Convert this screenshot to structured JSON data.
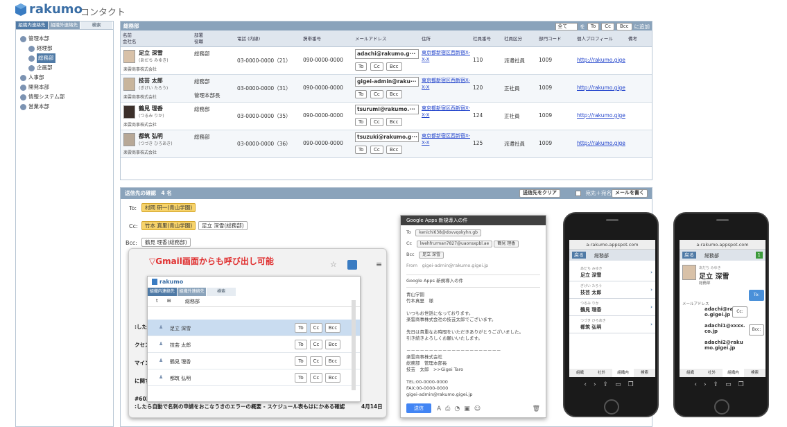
{
  "app": {
    "brand": "rakumo",
    "product": "コンタクト"
  },
  "left": {
    "tabs": [
      "組織内連絡先",
      "組織外連絡先",
      "検索"
    ],
    "tree": [
      {
        "label": "管理本部",
        "level": 1,
        "selected": false
      },
      {
        "label": "経理部",
        "level": 2,
        "selected": false
      },
      {
        "label": "総務部",
        "level": 2,
        "selected": true
      },
      {
        "label": "企画部",
        "level": 2,
        "selected": false
      },
      {
        "label": "人事部",
        "level": 1,
        "selected": false
      },
      {
        "label": "開発本部",
        "level": 1,
        "selected": false
      },
      {
        "label": "情報システム部",
        "level": 1,
        "selected": false
      },
      {
        "label": "営業本部",
        "level": 1,
        "selected": false
      }
    ]
  },
  "main": {
    "title": "総務部",
    "filter_value": "全て",
    "filter_word": "を",
    "to": "To",
    "cc": "Cc",
    "bcc": "Bcc",
    "add": "に追加",
    "columns": {
      "name": "名前",
      "company": "会社名",
      "dept": "部署",
      "role": "役職",
      "tel": "電話 (内線)",
      "mobile": "携帯番号",
      "mail": "メールアドレス",
      "address": "住所",
      "empno": "社員番号",
      "kind": "社員区分",
      "code": "部門コード",
      "profile": "個人プロフィール",
      "note": "備考"
    },
    "rows": [
      {
        "name": "足立 深雪",
        "kana": "(あだち みゆき)",
        "company": "楽雲商事株式会社",
        "dept": "総務部",
        "role": "",
        "tel": "03-0000-0000（21）",
        "mobile": "090-0000-0000",
        "mail": "adachi@rakumo.g···",
        "address": "東京都新宿区西新宿X-X-X",
        "empno": "110",
        "kind": "派遣社員",
        "code": "1009",
        "profile": "http://rakumo.gige"
      },
      {
        "name": "技芸 太郎",
        "kana": "(ぎげい たろう)",
        "company": "楽雲商事株式会社",
        "dept": "総務部",
        "role": "管理本部長",
        "tel": "03-0000-0000（31）",
        "mobile": "090-0000-0000",
        "mail": "gigei-admin@raku···",
        "address": "東京都新宿区西新宿X-X-X",
        "empno": "120",
        "kind": "正社員",
        "code": "1009",
        "profile": "http://rakumo.gige"
      },
      {
        "name": "鶴見 理香",
        "kana": "(つるみ りか)",
        "company": "楽雲商事株式会社",
        "dept": "総務部",
        "role": "",
        "tel": "03-0000-0000（35）",
        "mobile": "090-0000-0000",
        "mail": "tsurumi@rakumo.···",
        "address": "東京都新宿区西新宿X-X-X",
        "empno": "124",
        "kind": "正社員",
        "code": "1009",
        "profile": "http://rakumo.gige"
      },
      {
        "name": "都筑 弘明",
        "kana": "(つづき ひろあき)",
        "company": "楽雲商事株式会社",
        "dept": "総務部",
        "role": "",
        "tel": "03-0000-0000（36）",
        "mobile": "090-0000-0000",
        "mail": "tsuzuki@rakumo.g···",
        "address": "東京都新宿区西新宿X-X-X",
        "empno": "125",
        "kind": "派遣社員",
        "code": "1009",
        "profile": "http://rakumo.gige"
      }
    ]
  },
  "confirm": {
    "title": "送信先の確認　4 名",
    "clear": "送信先をクリア",
    "checkbox_label": "宛先＋宛名",
    "write": "メールを書く",
    "to_label": "To:",
    "cc_label": "Cc:",
    "bcc_label": "Bcc:",
    "to": [
      "村岡 研一(青山学園)"
    ],
    "cc": [
      "竹本 真里(青山学園)",
      "足立 深雪(総務部)"
    ],
    "bcc": [
      "鶴見 理香(総務部)"
    ]
  },
  "gmail": {
    "headline": "▽Gmail画面からも呼び出し可能",
    "brand": "rakumo",
    "tabs": [
      "組織内連絡先",
      "組織外連絡先",
      "検索"
    ],
    "group": "総務部",
    "people": [
      "足立 深雪",
      "技芸 太郎",
      "鶴見 理香",
      "都筑 弘明"
    ],
    "bg_lines": [
      ":したら",
      "クセス",
      "マイン",
      "に関す",
      "#6030",
      ":したら自動で名刺の申請をおこなうきのエラーの概要 - スケジュール表もはにかある確認"
    ],
    "date": "4月14日"
  },
  "compose": {
    "title": "Google Apps 新規導入の件",
    "to_label": "To",
    "cc_label": "Cc",
    "bcc_label": "Bcc",
    "from_label": "From",
    "to": "kenichi638@dovvqokyhn.gb",
    "cc1": "lwehfrurman7827@uaonsxpbl.ae",
    "cc2": "鶴見 理香",
    "bcc": "足立 深雪",
    "from": "gigei-admin@rakumo.gigei.jp",
    "subject": "Google Apps 新規導入の件",
    "body": [
      "青山学園",
      "竹本真里　様",
      "",
      "いつもお世話になっております。",
      "楽雲商事株式会社の技芸太郎でございます。",
      "",
      "先日は貴重なお時間をいただきありがとうございました。",
      "引き続きよろしくお願いいたします。",
      "",
      "－－－－－－－－－－－－－－－－－－－－－",
      "楽雲商事株式会社",
      "総務部　管理本部長",
      "技芸　太郎　>>Gigei Taro",
      "",
      "TEL:00-0000-0000",
      "FAX:00-0000-0000",
      "gigei-admin@rakumo.gigei.jp"
    ],
    "send": "送信"
  },
  "phone1": {
    "url": "a-rakumo.appspot.com",
    "back": "戻る",
    "group": "総務部",
    "people": [
      {
        "kana": "あだち みゆき",
        "name": "足立 深雪"
      },
      {
        "kana": "ぎげい たろう",
        "name": "技芸 太郎"
      },
      {
        "kana": "つるみ りか",
        "name": "鶴見 理香"
      },
      {
        "kana": "つづき ひろあき",
        "name": "都筑 弘明"
      }
    ],
    "tabs": [
      "組織",
      "社外",
      "組織内",
      "検索"
    ]
  },
  "phone2": {
    "url": "a-rakumo.appspot.com",
    "back": "戻る",
    "group": "総務部",
    "badge": "1",
    "kana": "あだち みゆき",
    "name": "足立 深雪",
    "dept": "総務部",
    "mail_label": "メールアドレス",
    "mail1": "adachi@rakumo.gigei.jp",
    "mail2": "adachi1@xxxx.co.jp",
    "mail3": "adachi2@rakumo.gigei.jp",
    "to": "To:",
    "cc": "Cc:",
    "bcc": "Bcc:",
    "tabs": [
      "組織",
      "社外",
      "組織内",
      "検索"
    ]
  },
  "colors": {
    "accent": "#4f7aa6",
    "header_bar": "#8aa3bb",
    "to_chip": "#f7d36a",
    "send": "#4285f4"
  }
}
